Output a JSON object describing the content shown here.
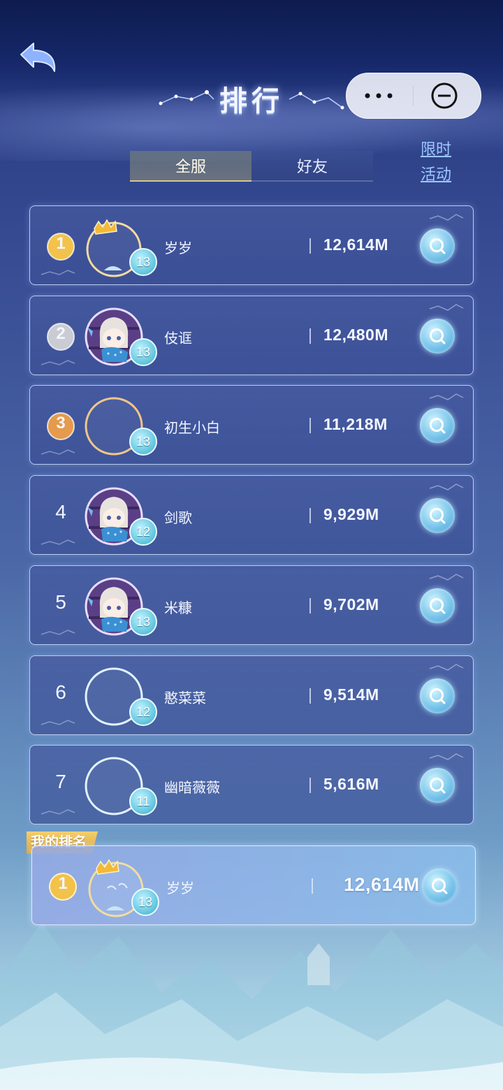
{
  "header": {
    "title": "排行",
    "capsule_more_icon": "ellipsis-icon",
    "capsule_close_icon": "minus-circle-icon",
    "back_icon": "back-arrow-icon"
  },
  "tabs": [
    {
      "label": "全服",
      "active": true
    },
    {
      "label": "好友",
      "active": false
    }
  ],
  "event_link": {
    "line1": "限时",
    "line2": "活动"
  },
  "ranking": [
    {
      "rank": "1",
      "medal": "gold",
      "name": "岁岁",
      "level": "13",
      "score": "12,614M",
      "avatar": "crown-ring"
    },
    {
      "rank": "2",
      "medal": "silver",
      "name": "伎诓",
      "level": "13",
      "score": "12,480M",
      "avatar": "character"
    },
    {
      "rank": "3",
      "medal": "bronze",
      "name": "初生小白",
      "level": "13",
      "score": "11,218M",
      "avatar": "bronze-ring"
    },
    {
      "rank": "4",
      "medal": "",
      "name": "剑歌",
      "level": "12",
      "score": "9,929M",
      "avatar": "character"
    },
    {
      "rank": "5",
      "medal": "",
      "name": "米糠",
      "level": "13",
      "score": "9,702M",
      "avatar": "character"
    },
    {
      "rank": "6",
      "medal": "",
      "name": "憨菜菜",
      "level": "12",
      "score": "9,514M",
      "avatar": "plain-ring"
    },
    {
      "rank": "7",
      "medal": "",
      "name": "幽暗薇薇",
      "level": "11",
      "score": "5,616M",
      "avatar": "plain-ring"
    }
  ],
  "my_rank": {
    "tag": "我的排名",
    "rank": "1",
    "name": "岁岁",
    "level": "13",
    "score": "12,614M"
  },
  "colors": {
    "gold": "#f2c24a",
    "silver": "#c9ccd3",
    "bronze": "#e59a4c",
    "accent_link": "#9cc8ff"
  }
}
